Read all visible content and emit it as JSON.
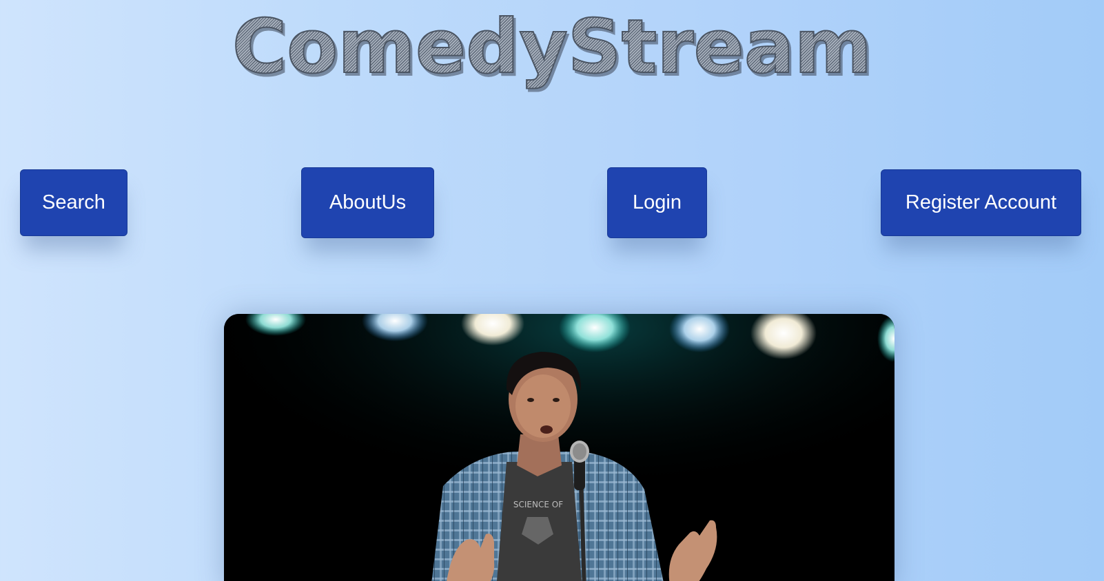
{
  "header": {
    "title": "ComedyStream"
  },
  "nav": {
    "search_label": "Search",
    "about_label": "AboutUs",
    "login_label": "Login",
    "register_label": "Register Account"
  },
  "hero": {
    "image": "comedian-on-stage-photo",
    "shirt_text": "SCIENCE OF"
  },
  "colors": {
    "button_bg": "#1f44b0",
    "button_text": "#ffffff",
    "background_start": "#cfe4fd",
    "background_end": "#a2cbf8",
    "title_text": "#7a8594"
  }
}
